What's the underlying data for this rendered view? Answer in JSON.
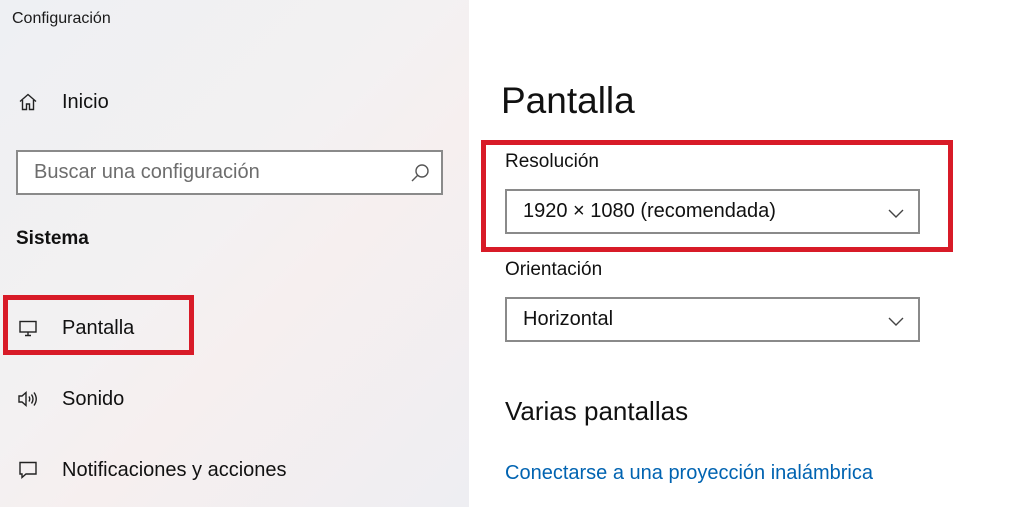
{
  "app": {
    "title": "Configuración"
  },
  "sidebar": {
    "home_label": "Inicio",
    "search_placeholder": "Buscar una configuración",
    "section_label": "Sistema",
    "items": [
      {
        "label": "Pantalla",
        "icon": "monitor-icon"
      },
      {
        "label": "Sonido",
        "icon": "speaker-icon"
      },
      {
        "label": "Notificaciones y acciones",
        "icon": "notification-icon"
      }
    ]
  },
  "main": {
    "title": "Pantalla",
    "resolution": {
      "label": "Resolución",
      "value": "1920 × 1080 (recomendada)"
    },
    "orientation": {
      "label": "Orientación",
      "value": "Horizontal"
    },
    "multi_display_heading": "Varias pantallas",
    "wireless_link": "Conectarse a una proyección inalámbrica"
  },
  "colors": {
    "highlight": "#d81b28",
    "link": "#0063b1"
  }
}
